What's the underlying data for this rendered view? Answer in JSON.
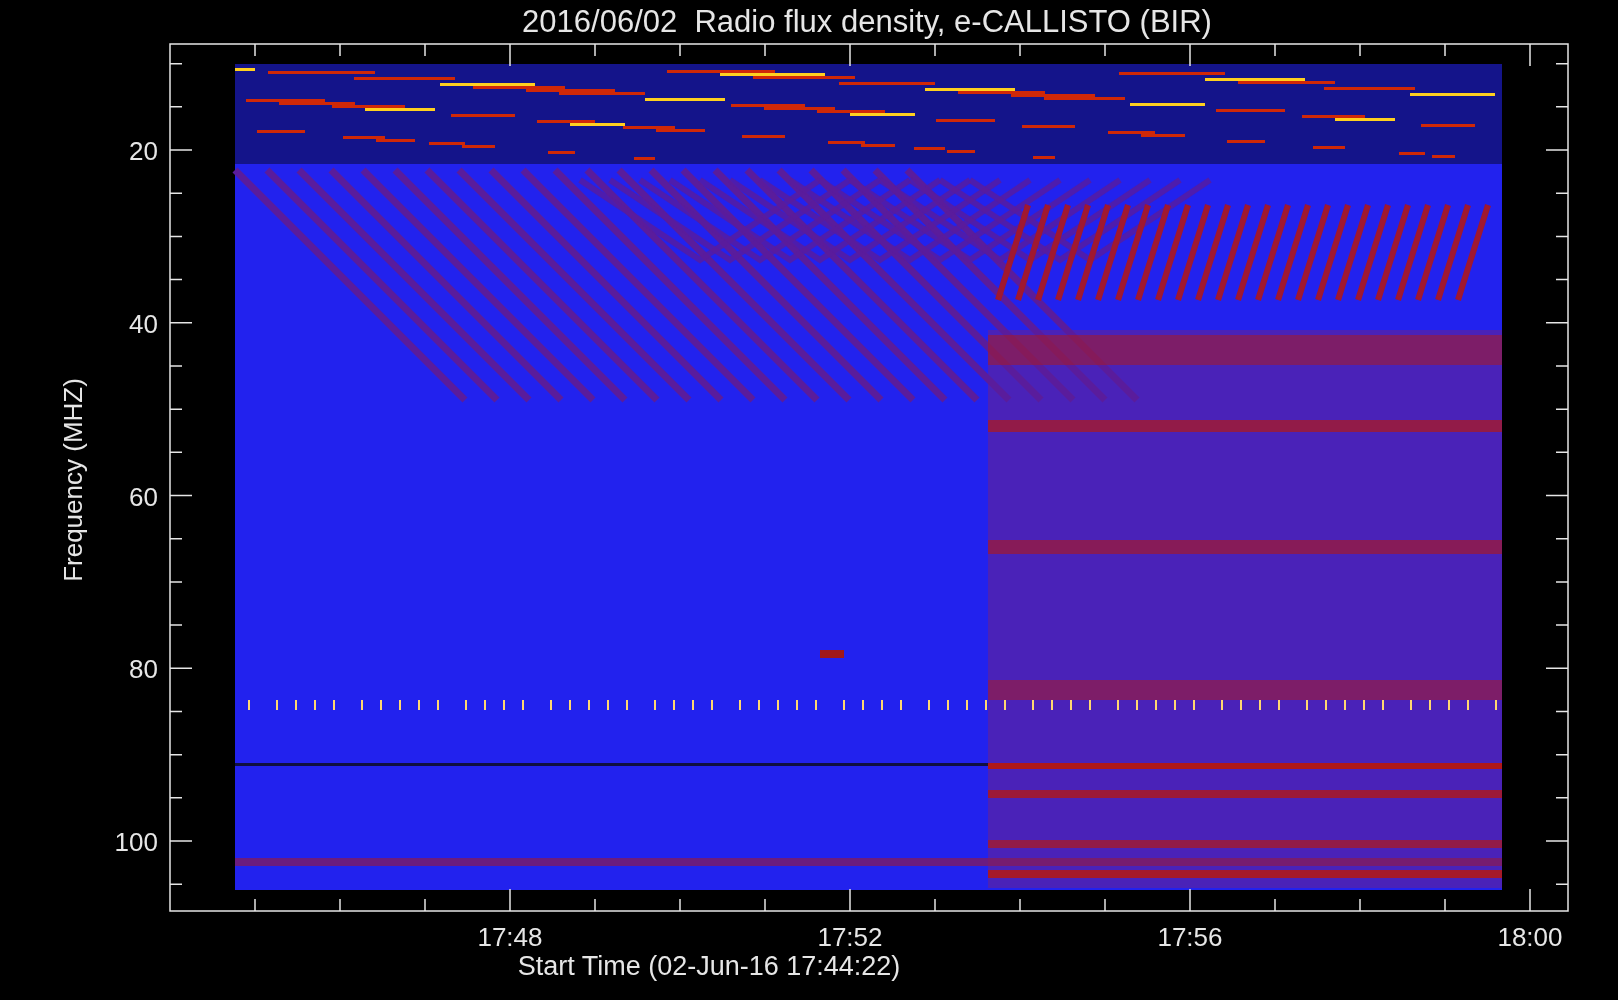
{
  "title": "2016/06/02  Radio flux density, e-CALLISTO (BIR)",
  "ylabel": "Frequency (MHZ)",
  "xlabel": "Start Time (02-Jun-16 17:44:22)",
  "yticks": [
    "20",
    "40",
    "60",
    "80",
    "100"
  ],
  "xticks": [
    "17:48",
    "17:52",
    "17:56",
    "18:00"
  ]
}
